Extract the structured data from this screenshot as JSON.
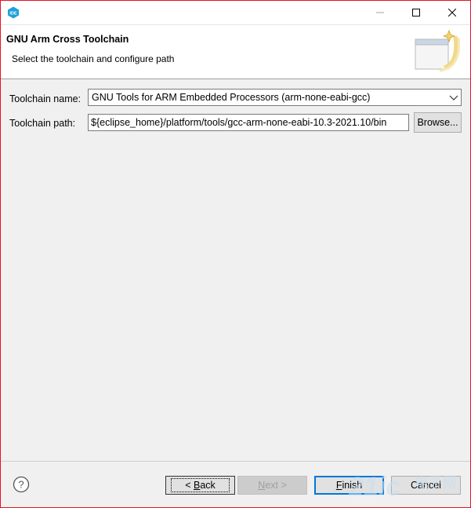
{
  "window": {
    "app_icon": "ide-icon",
    "controls": [
      "minimize-icon",
      "maximize-icon",
      "close-icon"
    ]
  },
  "header": {
    "title": "GNU Arm Cross Toolchain",
    "description": "Select the toolchain and configure path",
    "banner_icon": "wizard-banner-icon"
  },
  "form": {
    "name_label": "Toolchain name:",
    "name_value": "GNU Tools for ARM Embedded Processors (arm-none-eabi-gcc)",
    "path_label": "Toolchain path:",
    "path_value": "${eclipse_home}/platform/tools/gcc-arm-none-eabi-10.3-2021.10/bin",
    "browse_label": "Browse..."
  },
  "footer": {
    "help_icon": "help-icon",
    "back_mnemonic": "B",
    "back_rest": "ack",
    "back_prefix": "< ",
    "next_mnemonic": "N",
    "next_rest": "ext",
    "next_suffix": " >",
    "finish_mnemonic": "F",
    "finish_rest": "inish",
    "cancel_label": "Cancel"
  },
  "colors": {
    "accent": "#0078d7",
    "window_border": "#e81123",
    "dialog_bg": "#f0f0f0"
  }
}
